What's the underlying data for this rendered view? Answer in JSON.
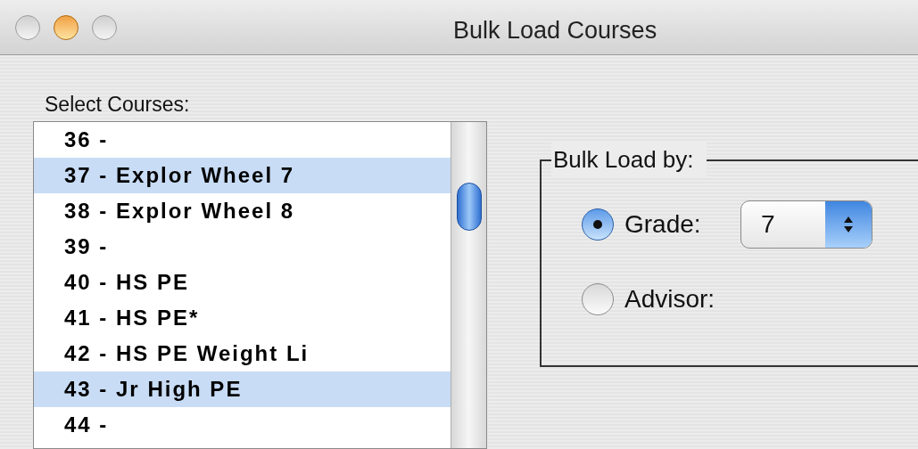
{
  "window": {
    "title": "Bulk Load Courses"
  },
  "courses": {
    "label": "Select Courses:",
    "items": [
      {
        "text": "36 -",
        "selected": false
      },
      {
        "text": "37 - Explor Wheel 7",
        "selected": true
      },
      {
        "text": "38 - Explor Wheel 8",
        "selected": false
      },
      {
        "text": "39 -",
        "selected": false
      },
      {
        "text": "40 - HS PE",
        "selected": false
      },
      {
        "text": "41 - HS PE*",
        "selected": false
      },
      {
        "text": "42 - HS PE Weight Li",
        "selected": false
      },
      {
        "text": "43 - Jr High PE",
        "selected": true
      },
      {
        "text": "44 -",
        "selected": false
      }
    ]
  },
  "bulk_load": {
    "label": "Bulk Load by:",
    "options": [
      {
        "label": "Grade:",
        "selected": true,
        "popup": "7"
      },
      {
        "label": "Advisor:",
        "selected": false
      }
    ]
  }
}
